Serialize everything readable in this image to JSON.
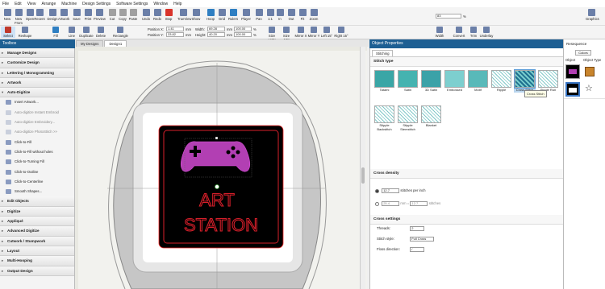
{
  "menu": [
    "File",
    "Edit",
    "View",
    "Arrange",
    "Machine",
    "Design Settings",
    "Software Settings",
    "Window",
    "Help"
  ],
  "toolbar_main": [
    {
      "label": "New",
      "icon": "new-file-icon"
    },
    {
      "label": "New From",
      "icon": "new-from-icon"
    },
    {
      "label": "Open",
      "icon": "open-folder-icon"
    },
    {
      "label": "Recent",
      "icon": "recent-icon"
    },
    {
      "label": "Design",
      "icon": "design-icon"
    },
    {
      "label": "Artwork",
      "icon": "artwork-icon"
    },
    {
      "label": "Save",
      "icon": "save-icon"
    },
    {
      "label": "Print",
      "icon": "print-icon"
    },
    {
      "label": "Preview",
      "icon": "preview-icon"
    },
    {
      "label": "Cut",
      "icon": "scissors-icon"
    },
    {
      "label": "Copy",
      "icon": "copy-icon"
    },
    {
      "label": "Paste",
      "icon": "paste-icon"
    },
    {
      "label": "Undo",
      "icon": "undo-icon"
    },
    {
      "label": "Redo",
      "icon": "redo-icon"
    },
    {
      "label": "Stop",
      "icon": "stop-icon"
    },
    {
      "label": "TrueView",
      "icon": "trueview-icon"
    },
    {
      "label": "Show",
      "icon": "show-icon"
    },
    {
      "label": "Hoop",
      "icon": "hoop-icon"
    },
    {
      "label": "Grid",
      "icon": "grid-icon"
    },
    {
      "label": "Rulers",
      "icon": "rulers-icon"
    },
    {
      "label": "Player",
      "icon": "player-icon"
    },
    {
      "label": "Pan",
      "icon": "pan-icon"
    },
    {
      "label": "1:1",
      "icon": "one-to-one-icon"
    },
    {
      "label": "In",
      "icon": "zoom-in-icon"
    },
    {
      "label": "Out",
      "icon": "zoom-out-icon"
    },
    {
      "label": "Fit",
      "icon": "fit-icon"
    },
    {
      "label": "Zoom",
      "icon": "zoom-icon"
    },
    {
      "label": "Graphics",
      "icon": "graphics-icon"
    }
  ],
  "zoom_value": "83",
  "zoom_unit": "%",
  "toolbar_second": [
    {
      "label": "Select",
      "icon": "select-arrow-icon"
    },
    {
      "label": "Reshape",
      "icon": "reshape-icon"
    },
    {
      "label": "Fill",
      "icon": "fill-icon"
    },
    {
      "label": "Line",
      "icon": "line-icon"
    },
    {
      "label": "Duplicate",
      "icon": "duplicate-icon"
    },
    {
      "label": "Delete",
      "icon": "delete-icon"
    },
    {
      "label": "Rectangle",
      "icon": "rectangle-icon"
    },
    {
      "label": "Size +10%",
      "icon": "size-up-icon"
    },
    {
      "label": "Size -10%",
      "icon": "size-down-icon"
    },
    {
      "label": "Mirror X",
      "icon": "mirror-x-icon"
    },
    {
      "label": "Mirror Y",
      "icon": "mirror-y-icon"
    },
    {
      "label": "Left 15°",
      "icon": "rotate-left-icon"
    },
    {
      "label": "Right 15°",
      "icon": "rotate-right-icon"
    },
    {
      "label": "Width",
      "icon": "width-icon"
    },
    {
      "label": "Convert",
      "icon": "convert-icon"
    },
    {
      "label": "Trim",
      "icon": "trim-icon"
    },
    {
      "label": "Underlay",
      "icon": "underlay-icon"
    }
  ],
  "position": {
    "label": "Position X:",
    "x": "1.41",
    "y_label": "Position Y:",
    "y": "33.82",
    "unit": "mm"
  },
  "size": {
    "w_label": "Width:",
    "w": "69.28",
    "h_label": "Height:",
    "h": "40.20",
    "unit": "mm",
    "w_pct": "100.00",
    "h_pct": "100.00",
    "pct_unit": "%"
  },
  "toolbox": {
    "title": "Toolbox",
    "sections": [
      {
        "label": "Manage Designs"
      },
      {
        "label": "Customize Design"
      },
      {
        "label": "Lettering / Monogramming"
      },
      {
        "label": "Artwork"
      },
      {
        "label": "Auto-Digitize",
        "open": true,
        "items": [
          {
            "label": "Insert Artwork...",
            "dim": false
          },
          {
            "label": "Auto-digitize Instant Embroid",
            "dim": true
          },
          {
            "label": "Auto-digitize Embroidery...",
            "dim": true
          },
          {
            "label": "Auto-digitize PhotoStitch >>",
            "dim": true
          },
          {
            "label": "Click-to-Fill",
            "dim": false
          },
          {
            "label": "Click-to-Fill without holes",
            "dim": false
          },
          {
            "label": "Click-to-Turning Fill",
            "dim": false
          },
          {
            "label": "Click-to-Outline",
            "dim": false
          },
          {
            "label": "Click-to-Centerline",
            "dim": false
          },
          {
            "label": "Smooth Shapes...",
            "dim": false
          }
        ]
      },
      {
        "label": "Edit Objects"
      },
      {
        "label": "Digitize"
      },
      {
        "label": "Appliqué"
      },
      {
        "label": "Advanced Digitize"
      },
      {
        "label": "Cutwork / Stumpwork"
      },
      {
        "label": "Layout"
      },
      {
        "label": "Multi-Hooping"
      },
      {
        "label": "Output Design"
      }
    ]
  },
  "canvas_tabs": [
    "My Designs",
    "Design1"
  ],
  "design": {
    "line1": "ART",
    "line2": "STATION",
    "text_color": "#d81f2a",
    "bg_color": "#000000",
    "controller_color": "#b23fb3"
  },
  "object_properties": {
    "title": "Object Properties",
    "tab": "Stitching",
    "stitch_type_label": "Stitch type",
    "stitch_types": [
      {
        "label": "Tatami",
        "sel": false
      },
      {
        "label": "Satin",
        "sel": false
      },
      {
        "label": "3D Satin",
        "sel": false
      },
      {
        "label": "Embossed",
        "sel": false
      },
      {
        "label": "Motif",
        "sel": false
      },
      {
        "label": "Ripple",
        "sel": false
      },
      {
        "label": "Cross Stitch",
        "sel": true
      },
      {
        "label": "Single Run",
        "sel": false
      },
      {
        "label": "Stipple Backstitch",
        "sel": false
      },
      {
        "label": "Stipple Stemstitch",
        "sel": false
      },
      {
        "label": "Blanket",
        "sel": false
      }
    ],
    "tooltip": "Cross Stitch",
    "density_label": "Cross density",
    "density_value": "12.7",
    "density_unit": "stitches per inch",
    "density2_a": "25.4",
    "density2_sep": "mm =",
    "density2_b": "12.7",
    "density2_unit": "stitches",
    "settings_label": "Cross settings",
    "threads_label": "Threads:",
    "threads_value": "2",
    "style_label": "Stitch style:",
    "style_value": "Full Cross",
    "floss_label": "Floss direction:",
    "floss_value": "/"
  },
  "resequence": {
    "title": "Resequence",
    "colors_btn": "Colors",
    "col_object": "Object",
    "col_type": "Object Type"
  }
}
